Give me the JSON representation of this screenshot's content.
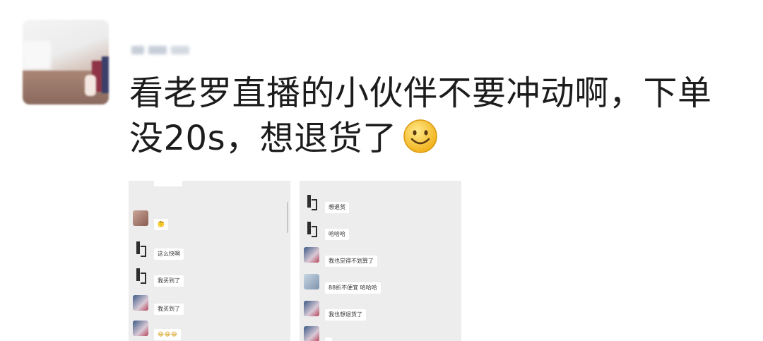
{
  "post": {
    "text": "看老罗直播的小伙伴不要冲动啊，下单没20s，想退货了",
    "emoji_icon": "smiley-face-icon"
  },
  "screenshot_left": {
    "messages": [
      {
        "bubble": "🤔"
      },
      {
        "bubble": "这么快啊"
      },
      {
        "bubble": "我买到了"
      },
      {
        "bubble": "我买到了"
      },
      {
        "bubble": "😂😂😂"
      }
    ]
  },
  "screenshot_right": {
    "messages": [
      {
        "bubble": "想退货"
      },
      {
        "bubble": "哈哈哈"
      },
      {
        "bubble": "我也觉得不划算了"
      },
      {
        "bubble": "88折不便宜 哈哈哈"
      },
      {
        "bubble": "我也想退货了"
      },
      {
        "bubble": ""
      }
    ]
  }
}
